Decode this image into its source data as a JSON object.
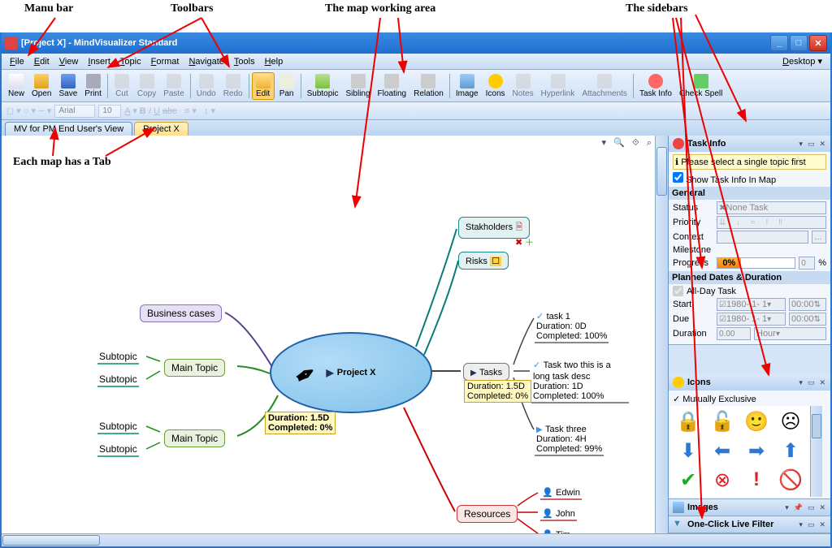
{
  "annotations": {
    "menubar": "Manu bar",
    "toolbars": "Toolbars",
    "workarea": "The map working area",
    "sidebars": "The sidebars",
    "tabs": "Each map has a Tab"
  },
  "titlebar": {
    "title": "[Project X] - MindVisualizer Standard"
  },
  "menubar": {
    "items": [
      "File",
      "Edit",
      "View",
      "Insert",
      "Topic",
      "Format",
      "Navigate",
      "Tools",
      "Help"
    ],
    "right": "Desktop"
  },
  "toolbar": {
    "new": "New",
    "open": "Open",
    "save": "Save",
    "print": "Print",
    "cut": "Cut",
    "copy": "Copy",
    "paste": "Paste",
    "undo": "Undo",
    "redo": "Redo",
    "edit": "Edit",
    "pan": "Pan",
    "subtopic": "Subtopic",
    "sibling": "Sibling",
    "floating": "Floating",
    "relation": "Relation",
    "image": "Image",
    "icons": "Icons",
    "notes": "Notes",
    "hyperlink": "Hyperlink",
    "attachments": "Attachments",
    "taskinfo": "Task Info",
    "checkspell": "Check Spell"
  },
  "toolbar2": {
    "font": "Arial",
    "size": "10"
  },
  "tabs": {
    "tab1": "MV for PM End User's View",
    "tab2": "Project X"
  },
  "map": {
    "central": "Project X",
    "central_task": {
      "duration": "Duration: 1.5D",
      "completed": "Completed: 0%"
    },
    "business": "Business cases",
    "maintopic1": "Main Topic",
    "maintopic2": "Main Topic",
    "sub1": "Subtopic",
    "sub2": "Subtopic",
    "sub3": "Subtopic",
    "sub4": "Subtopic",
    "stakeholders": "Stakholders",
    "risks": "Risks",
    "tasks": "Tasks",
    "tasks_task": {
      "duration": "Duration: 1.5D",
      "completed": "Completed: 0%"
    },
    "task1": "task 1",
    "task1_info": {
      "duration": "Duration: 0D",
      "completed": "Completed: 100%"
    },
    "task2": "Task two this is a\nlong task desc",
    "task2_info": {
      "duration": "Duration: 1D",
      "completed": "Completed: 100%"
    },
    "task3": "Task three",
    "task3_info": {
      "duration": "Duration: 4H",
      "completed": "Completed: 99%"
    },
    "resources": "Resources",
    "res1": "Edwin",
    "res2": "John",
    "res3": "Tim"
  },
  "taskinfo_panel": {
    "title": "Task Info",
    "hint": "Please select a single topic first",
    "show_in_map": "Show Task Info In Map",
    "general": "General",
    "status": "Status",
    "status_val": "None Task",
    "priority": "Priority",
    "context": "Context",
    "milestone": "Milestone",
    "progress": "Progress",
    "progress_val": "0%",
    "progress_pct": "%",
    "progress_num": "0",
    "planned": "Planned Dates & Duration",
    "allday": "All-Day Task",
    "start": "Start",
    "start_date": "1980- 1- 1",
    "start_time": "00:00",
    "due": "Due",
    "due_date": "1980- 1- 1",
    "due_time": "00:00",
    "duration": "Duration",
    "duration_val": "0.00",
    "duration_unit": "Hour"
  },
  "icons_panel": {
    "title": "Icons",
    "mutex": "Mutually Exclusive"
  },
  "images_panel": {
    "title": "Images"
  },
  "filter_panel": {
    "title": "One-Click Live Filter"
  }
}
